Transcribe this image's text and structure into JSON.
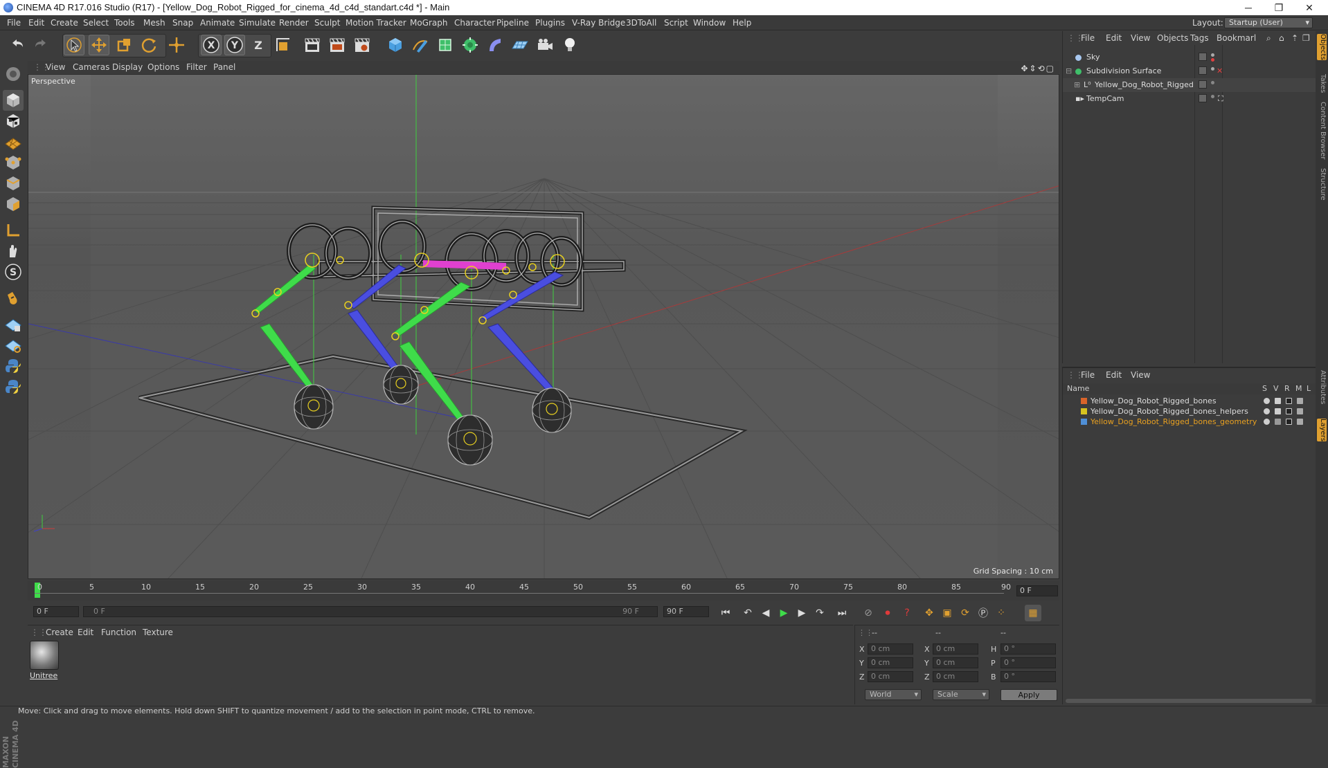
{
  "window": {
    "title": "CINEMA 4D R17.016 Studio (R17) - [Yellow_Dog_Robot_Rigged_for_cinema_4d_c4d_standart.c4d *] - Main"
  },
  "menu": {
    "items": [
      "File",
      "Edit",
      "Create",
      "Select",
      "Tools",
      "Mesh",
      "Snap",
      "Animate",
      "Simulate",
      "Render",
      "Sculpt",
      "Motion Tracker",
      "MoGraph",
      "Character",
      "Pipeline",
      "Plugins",
      "V-Ray Bridge",
      "3DToAll",
      "Script",
      "Window",
      "Help"
    ],
    "layout_label": "Layout:",
    "layout_value": "Startup (User)"
  },
  "toolbar": {
    "axis_x": "X",
    "axis_y": "Y",
    "axis_z": "Z"
  },
  "viewport": {
    "menu": [
      "View",
      "Cameras",
      "Display",
      "Options",
      "Filter",
      "Panel"
    ],
    "label": "Perspective",
    "grid_spacing": "Grid Spacing : 10 cm"
  },
  "timeline": {
    "ticks": [
      "0",
      "5",
      "10",
      "15",
      "20",
      "25",
      "30",
      "35",
      "40",
      "45",
      "50",
      "55",
      "60",
      "65",
      "70",
      "75",
      "80",
      "85",
      "90"
    ],
    "current_frame": "0 F"
  },
  "transport": {
    "start_field": "0 F",
    "range_start": "0 F",
    "range_end": "90 F",
    "end_field": "90 F"
  },
  "material_manager": {
    "menu": [
      "Create",
      "Edit",
      "Function",
      "Texture"
    ],
    "material_name": "Unitree"
  },
  "coordinates": {
    "headers": [
      "--",
      "--",
      "--"
    ],
    "rows": [
      {
        "a_label": "X",
        "a_val": "0 cm",
        "b_label": "X",
        "b_val": "0 cm",
        "c_label": "H",
        "c_val": "0 °"
      },
      {
        "a_label": "Y",
        "a_val": "0 cm",
        "b_label": "Y",
        "b_val": "0 cm",
        "c_label": "P",
        "c_val": "0 °"
      },
      {
        "a_label": "Z",
        "a_val": "0 cm",
        "b_label": "Z",
        "b_val": "0 cm",
        "c_label": "B",
        "c_val": "0 °"
      }
    ],
    "mode_world": "World",
    "mode_scale": "Scale",
    "apply": "Apply"
  },
  "object_manager": {
    "menu": [
      "File",
      "Edit",
      "View",
      "Objects",
      "Tags",
      "Bookmarl"
    ],
    "objects": [
      "Sky",
      "Subdivision Surface",
      "Yellow_Dog_Robot_Rigged",
      "TempCam"
    ]
  },
  "layer_manager": {
    "menu": [
      "File",
      "Edit",
      "View"
    ],
    "columns": {
      "name": "Name",
      "s": "S",
      "v": "V",
      "r": "R",
      "m": "M",
      "l": "L"
    },
    "layers": [
      {
        "name": "Yellow_Dog_Robot_Rigged_bones",
        "color": "#d9642a"
      },
      {
        "name": "Yellow_Dog_Robot_Rigged_bones_helpers",
        "color": "#d6c21f"
      },
      {
        "name": "Yellow_Dog_Robot_Rigged_bones_geometry",
        "color": "#4f8fd6"
      }
    ]
  },
  "side_tabs": [
    "Objects",
    "Takes",
    "Content Browser",
    "Structure",
    "Attributes",
    "Layers"
  ],
  "status": "Move: Click and drag to move elements. Hold down SHIFT to quantize movement / add to the selection in point mode, CTRL to remove.",
  "logo": "MAXON CINEMA 4D"
}
